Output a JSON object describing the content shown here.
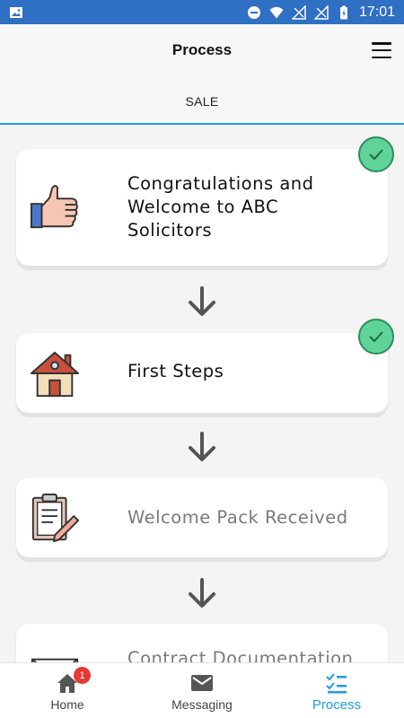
{
  "status_bar": {
    "time": "17:01",
    "icons": [
      "image-icon",
      "do-not-disturb-icon",
      "wifi-icon",
      "signal-icon",
      "signal-icon",
      "battery-icon"
    ]
  },
  "app_bar": {
    "title": "Process",
    "menu_icon": "hamburger-menu-icon"
  },
  "tabs": [
    {
      "label": "SALE",
      "active": true
    }
  ],
  "steps": [
    {
      "title": "Congratulations and Welcome to ABC Solicitors",
      "icon": "thumbs-up-icon",
      "completed": true
    },
    {
      "title": "First Steps",
      "icon": "house-icon",
      "completed": true
    },
    {
      "title": "Welcome Pack Received",
      "icon": "clipboard-icon",
      "completed": false
    },
    {
      "title": "Contract Documentation",
      "icon": "envelope-icon",
      "completed": false
    }
  ],
  "bottom_nav": {
    "items": [
      {
        "label": "Home",
        "icon": "home-icon",
        "badge": "1"
      },
      {
        "label": "Messaging",
        "icon": "mail-icon"
      },
      {
        "label": "Process",
        "icon": "checklist-icon",
        "active": true
      }
    ]
  },
  "colors": {
    "status_bar": "#2f6fc4",
    "accent": "#1e9de0",
    "check_badge": "#5fd39a",
    "notification_badge": "#e53935"
  }
}
